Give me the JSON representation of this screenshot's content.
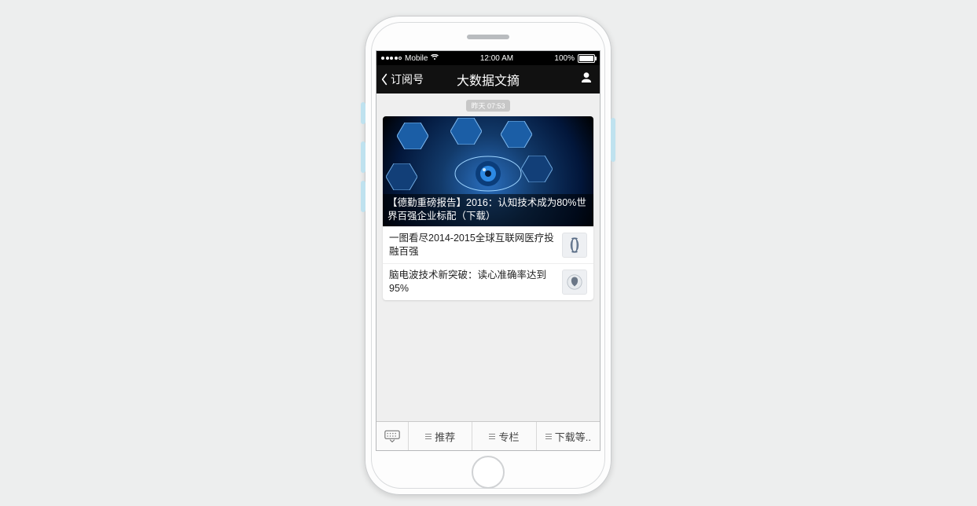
{
  "status": {
    "carrier": "Mobile",
    "time": "12:00 AM",
    "battery": "100%"
  },
  "nav": {
    "back_label": "订阅号",
    "title": "大数据文摘"
  },
  "feed": {
    "timestamp": "昨天 07:53",
    "hero_title": "【德勤重磅报告】2016：认知技术成为80%世界百强企业标配（下载）",
    "items": [
      {
        "title": "一图看尽2014-2015全球互联网医疗投融百强"
      },
      {
        "title": "脑电波技术新突破：读心准确率达到95%"
      }
    ]
  },
  "bottom": {
    "menu": [
      "推荐",
      "专栏",
      "下载等.."
    ]
  }
}
